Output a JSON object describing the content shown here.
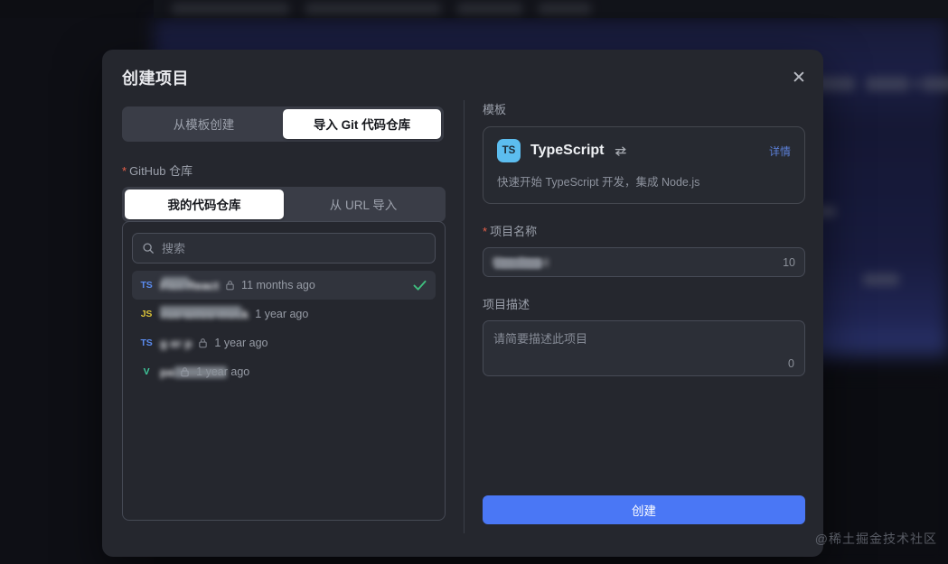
{
  "modal": {
    "title": "创建项目",
    "close_icon": "close-icon"
  },
  "source_tabs": {
    "items": [
      {
        "label": "从模板创建",
        "active": false
      },
      {
        "label": "导入 Git 代码仓库",
        "active": true
      }
    ]
  },
  "github_repo": {
    "label": "GitHub 仓库",
    "required_marker": "*",
    "tabs": [
      {
        "label": "我的代码仓库",
        "active": true
      },
      {
        "label": "从 URL 导入",
        "active": false
      }
    ],
    "search": {
      "placeholder": "搜索",
      "value": "",
      "icon": "search-icon"
    },
    "repos": [
      {
        "lang": "TS",
        "lang_class": "lang-ts",
        "name": "Flex React",
        "private": true,
        "updated": "11 months ago",
        "selected": true
      },
      {
        "lang": "JS",
        "lang_class": "lang-js",
        "name": "vue-axios-mock",
        "private": false,
        "updated": "1 year ago",
        "selected": false
      },
      {
        "lang": "TS",
        "lang_class": "lang-ts",
        "name": "g er  p",
        "private": true,
        "updated": "1 year ago",
        "selected": false
      },
      {
        "lang": "V",
        "lang_class": "lang-v",
        "name": "pa",
        "private": true,
        "updated": "1 year ago",
        "selected": false
      }
    ]
  },
  "template": {
    "section_label": "模板",
    "badge": "TS",
    "name": "TypeScript",
    "swap_icon": "swap-icon",
    "detail_link": "详情",
    "description": "快速开始 TypeScript 开发，集成 Node.js"
  },
  "project_name": {
    "label": "项目名称",
    "required_marker": "*",
    "value": "Flex React",
    "counter": "10"
  },
  "project_desc": {
    "label": "项目描述",
    "placeholder": "请简要描述此项目",
    "value": "",
    "counter": "0"
  },
  "actions": {
    "create_label": "创建"
  },
  "watermark": {
    "text": "@稀土掘金技术社区"
  },
  "colors": {
    "accent_blue": "#4a77f5",
    "link_blue": "#5b7fd6",
    "ts_badge": "#5cbdef",
    "check_green": "#3fbf7f",
    "required_red": "#e8604a"
  }
}
